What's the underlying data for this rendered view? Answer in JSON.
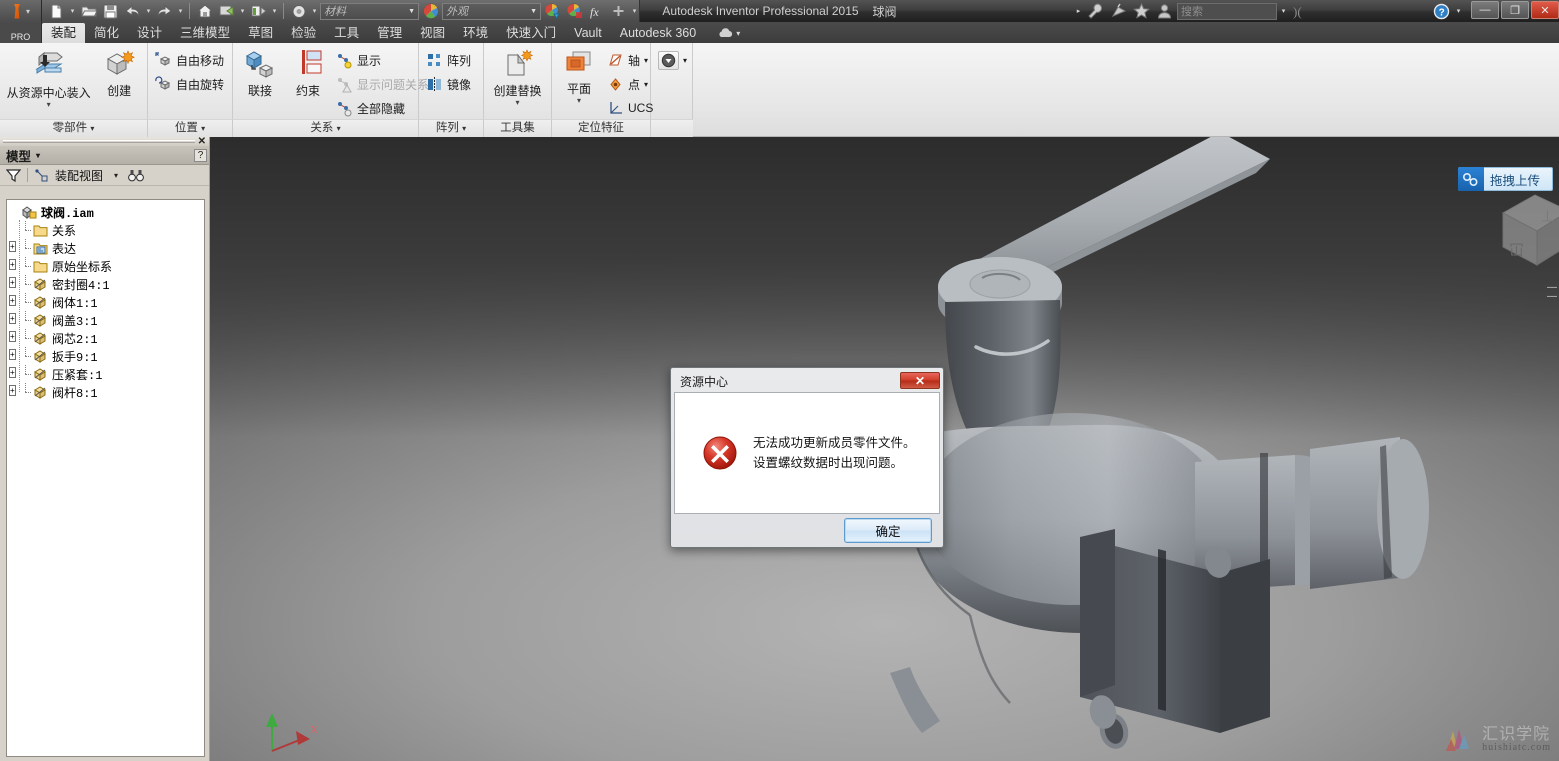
{
  "titlebar": {
    "app_title": "Autodesk Inventor Professional 2015",
    "document_title": "球阀",
    "material_placeholder": "材料",
    "appearance_placeholder": "外观",
    "search_placeholder": "搜索",
    "quick_access_icons": [
      "new-file-icon",
      "open-folder-icon",
      "save-icon",
      "undo-icon",
      "redo-icon",
      "home-icon",
      "return-icon",
      "update-icon",
      "select-icon"
    ],
    "right_icons": [
      "wrench-icon",
      "satellite-icon",
      "star-icon",
      "person-icon",
      "sign-in-icon",
      "help-icon"
    ],
    "window_buttons": {
      "minimize": "—",
      "maximize": "❐",
      "close": "✕"
    }
  },
  "tabs": {
    "pro_label": "PRO",
    "items": [
      {
        "label": "装配",
        "active": true
      },
      {
        "label": "简化",
        "active": false
      },
      {
        "label": "设计",
        "active": false
      },
      {
        "label": "三维模型",
        "active": false
      },
      {
        "label": "草图",
        "active": false
      },
      {
        "label": "检验",
        "active": false
      },
      {
        "label": "工具",
        "active": false
      },
      {
        "label": "管理",
        "active": false
      },
      {
        "label": "视图",
        "active": false
      },
      {
        "label": "环境",
        "active": false
      },
      {
        "label": "快速入门",
        "active": false
      },
      {
        "label": "Vault",
        "active": false
      },
      {
        "label": "Autodesk 360",
        "active": false
      }
    ]
  },
  "ribbon": {
    "groups": [
      {
        "label": "零部件",
        "has_dropdown": true,
        "big_buttons": [
          {
            "label": "从资源中心装入",
            "icon": "place-from-content-center-icon",
            "has_caret": true
          },
          {
            "label": "创建",
            "icon": "create-component-icon",
            "has_caret": false
          }
        ]
      },
      {
        "label": "位置",
        "has_dropdown": true,
        "small_buttons": [
          {
            "label": "自由移动",
            "icon": "free-move-icon",
            "disabled": false
          },
          {
            "label": "自由旋转",
            "icon": "free-rotate-icon",
            "disabled": false
          }
        ]
      },
      {
        "label": "关系",
        "has_dropdown": true,
        "big_buttons": [
          {
            "label": "联接",
            "icon": "joint-icon",
            "has_caret": false
          },
          {
            "label": "约束",
            "icon": "constrain-icon",
            "has_caret": false
          }
        ],
        "small_buttons": [
          {
            "label": "显示",
            "icon": "show-relations-icon",
            "disabled": false
          },
          {
            "label": "显示问题关系",
            "icon": "show-sick-relations-icon",
            "disabled": true
          },
          {
            "label": "全部隐藏",
            "icon": "hide-all-relations-icon",
            "disabled": false
          }
        ]
      },
      {
        "label": "阵列",
        "has_dropdown": true,
        "small_buttons": [
          {
            "label": "阵列",
            "icon": "pattern-icon",
            "disabled": false
          },
          {
            "label": "镜像",
            "icon": "mirror-icon",
            "disabled": false
          }
        ]
      },
      {
        "label": "工具集",
        "has_dropdown": false,
        "big_buttons": [
          {
            "label": "创建替换",
            "icon": "create-substitute-icon",
            "has_caret": true
          }
        ]
      },
      {
        "label": "定位特征",
        "has_dropdown": false,
        "big_buttons": [
          {
            "label": "平面",
            "icon": "work-plane-icon",
            "has_caret": true
          }
        ],
        "small_buttons": [
          {
            "label": "轴",
            "icon": "work-axis-icon",
            "disabled": false,
            "has_caret": true
          },
          {
            "label": "点",
            "icon": "work-point-icon",
            "disabled": false,
            "has_caret": true
          },
          {
            "label": "UCS",
            "icon": "ucs-icon",
            "disabled": false,
            "has_caret": false
          }
        ]
      }
    ],
    "overflow_icon": "ribbon-overflow-icon"
  },
  "browser": {
    "panel_title": "模型",
    "help_label": "?",
    "close_label": "✕",
    "toolbar": {
      "filter_icon": "filter-funnel-icon",
      "view_label": "装配视图",
      "view_caret": "▾",
      "find_icon": "binoculars-icon"
    },
    "tree": [
      {
        "label": "球阀.iam",
        "level": 0,
        "expander": "none",
        "icon": "assembly-icon",
        "bold": true
      },
      {
        "label": "关系",
        "level": 1,
        "expander": "none",
        "icon": "folder-icon",
        "bold": false
      },
      {
        "label": "表达",
        "level": 1,
        "expander": "plus",
        "icon": "representation-icon",
        "bold": false
      },
      {
        "label": "原始坐标系",
        "level": 1,
        "expander": "plus",
        "icon": "folder-icon",
        "bold": false
      },
      {
        "label": "密封圈4:1",
        "level": 1,
        "expander": "plus",
        "icon": "part-icon",
        "bold": false
      },
      {
        "label": "阀体1:1",
        "level": 1,
        "expander": "plus",
        "icon": "part-icon",
        "bold": false
      },
      {
        "label": "阀盖3:1",
        "level": 1,
        "expander": "plus",
        "icon": "part-icon",
        "bold": false
      },
      {
        "label": "阀芯2:1",
        "level": 1,
        "expander": "plus",
        "icon": "part-icon",
        "bold": false
      },
      {
        "label": "扳手9:1",
        "level": 1,
        "expander": "plus",
        "icon": "part-icon",
        "bold": false
      },
      {
        "label": "压紧套:1",
        "level": 1,
        "expander": "plus",
        "icon": "part-icon",
        "bold": false
      },
      {
        "label": "阀杆8:1",
        "level": 1,
        "expander": "plus",
        "icon": "part-icon",
        "bold": false
      }
    ]
  },
  "viewport": {
    "model_name": "ball-valve-assembly",
    "axis_labels": {
      "x": "X",
      "y": "Y"
    },
    "viewcube_icon": "view-cube-icon",
    "upload_button": {
      "label": "拖拽上传",
      "icon": "drag-upload-icon",
      "accent": "#1862ad"
    },
    "watermark": {
      "cn": "汇识学院",
      "en": "huishiatc.com"
    }
  },
  "dialog": {
    "title": "资源中心",
    "close_label": "✕",
    "icon": "error-cross-icon",
    "message_line1": "无法成功更新成员零件文件。",
    "message_line2": "设置螺纹数据时出现问题。",
    "ok_label": "确定",
    "accent": "#cf3d29"
  }
}
